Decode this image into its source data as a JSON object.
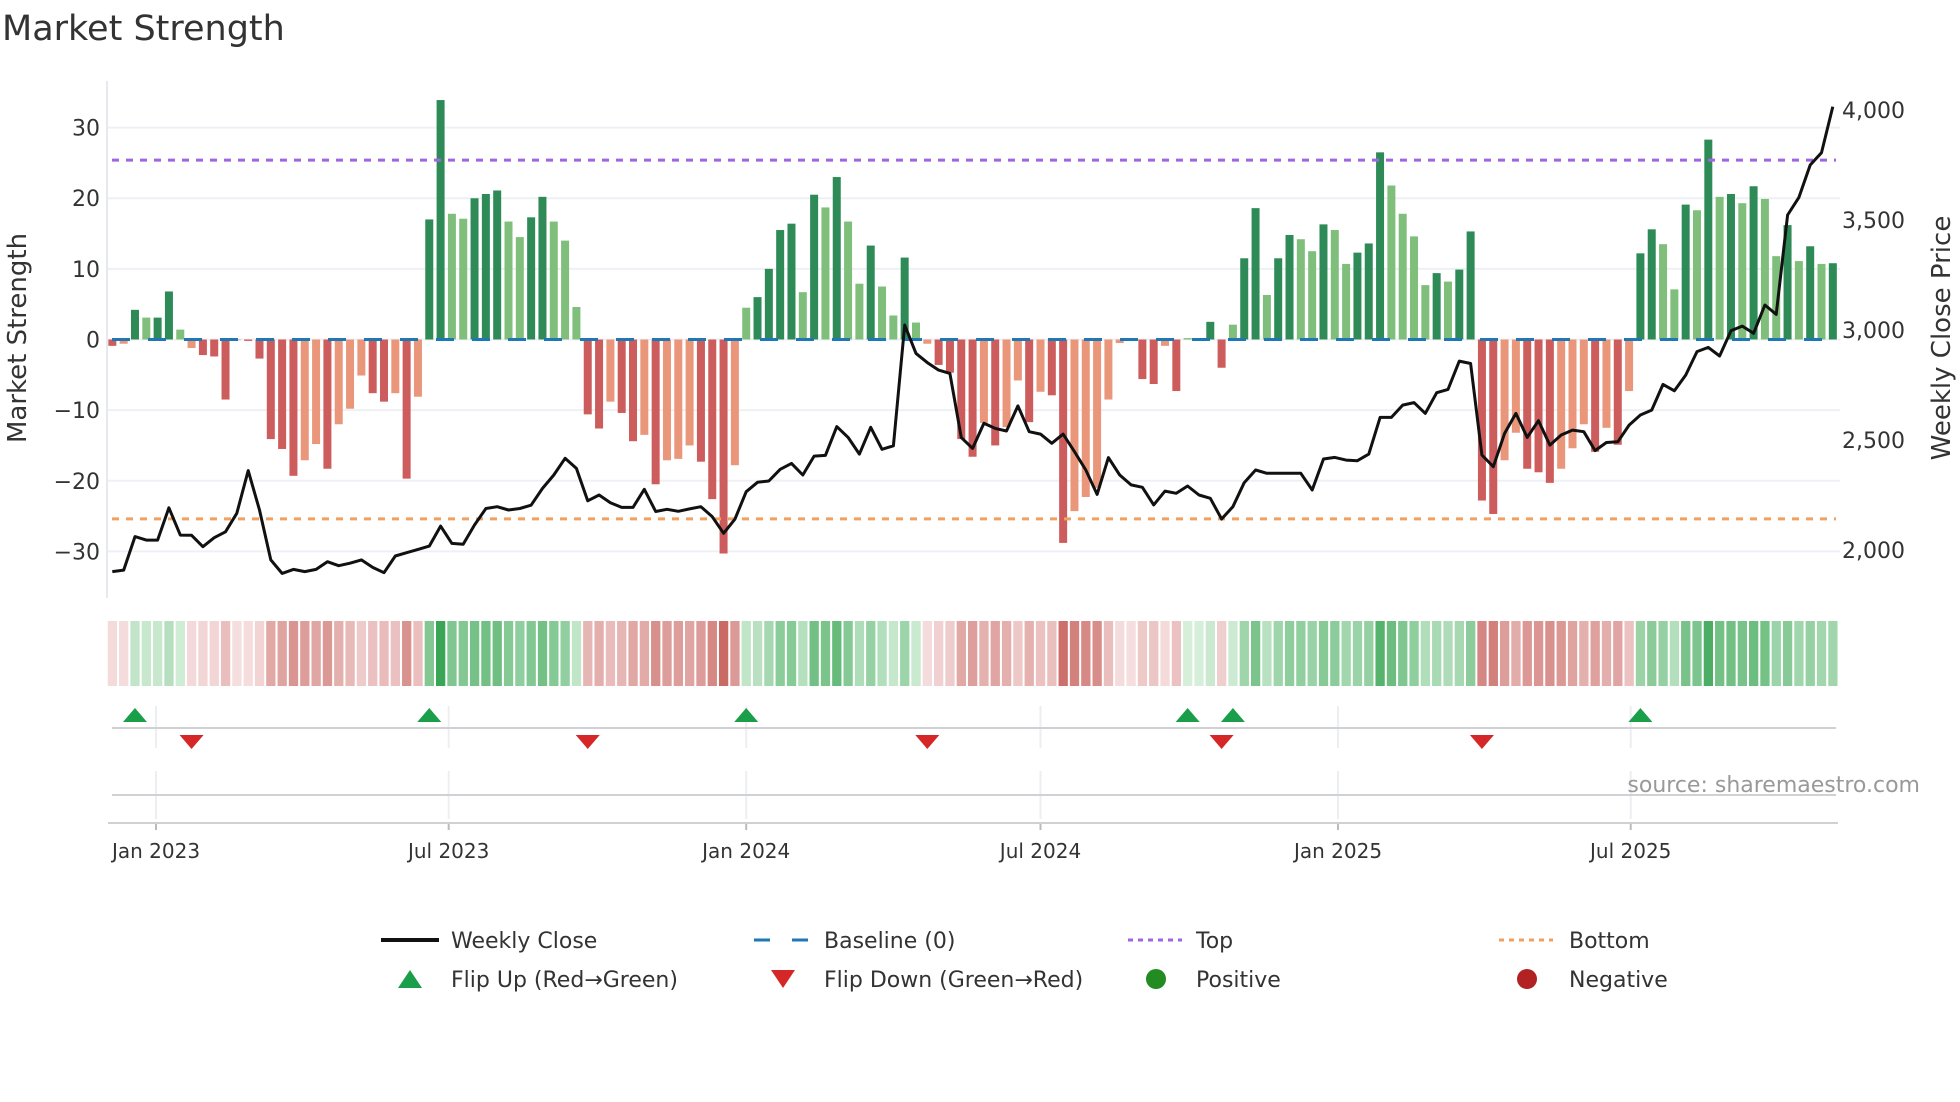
{
  "chart_data": {
    "type": "bar",
    "title": "Market Strength",
    "ylabel": "Market Strength",
    "y2label": "Weekly Close Price",
    "ylim": [
      -36.6,
      36.6
    ],
    "y2lim": [
      1782,
      4132
    ],
    "yticks": [
      -30,
      -20,
      -10,
      0,
      10,
      20,
      30
    ],
    "y2ticks": [
      2000,
      2500,
      3000,
      3500,
      4000
    ],
    "y2tick_labels": [
      "2,000",
      "2,500",
      "3,000",
      "3,500",
      "4,000"
    ],
    "xticks": [
      {
        "date": "2023-01-01",
        "label": "Jan 2023"
      },
      {
        "date": "2023-07-01",
        "label": "Jul 2023"
      },
      {
        "date": "2024-01-01",
        "label": "Jan 2024"
      },
      {
        "date": "2024-07-01",
        "label": "Jul 2024"
      },
      {
        "date": "2025-01-01",
        "label": "Jan 2025"
      },
      {
        "date": "2025-07-01",
        "label": "Jul 2025"
      }
    ],
    "grid": true,
    "legend_placement": "bottom",
    "top_threshold": 25.4,
    "bottom_threshold": -25.4,
    "baseline": 0,
    "x": [
      "2022-12-05",
      "2022-12-12",
      "2022-12-19",
      "2022-12-26",
      "2023-01-02",
      "2023-01-09",
      "2023-01-16",
      "2023-01-23",
      "2023-01-30",
      "2023-02-06",
      "2023-02-13",
      "2023-02-20",
      "2023-02-27",
      "2023-03-06",
      "2023-03-13",
      "2023-03-20",
      "2023-03-27",
      "2023-04-03",
      "2023-04-10",
      "2023-04-17",
      "2023-04-24",
      "2023-05-01",
      "2023-05-08",
      "2023-05-15",
      "2023-05-22",
      "2023-05-29",
      "2023-06-05",
      "2023-06-12",
      "2023-06-19",
      "2023-06-26",
      "2023-07-03",
      "2023-07-10",
      "2023-07-17",
      "2023-07-24",
      "2023-07-31",
      "2023-08-07",
      "2023-08-14",
      "2023-08-21",
      "2023-08-28",
      "2023-09-04",
      "2023-09-11",
      "2023-09-18",
      "2023-09-25",
      "2023-10-02",
      "2023-10-09",
      "2023-10-16",
      "2023-10-23",
      "2023-10-30",
      "2023-11-06",
      "2023-11-13",
      "2023-11-20",
      "2023-11-27",
      "2023-12-04",
      "2023-12-11",
      "2023-12-18",
      "2023-12-25",
      "2024-01-01",
      "2024-01-08",
      "2024-01-15",
      "2024-01-22",
      "2024-01-29",
      "2024-02-05",
      "2024-02-12",
      "2024-02-19",
      "2024-02-26",
      "2024-03-04",
      "2024-03-11",
      "2024-03-18",
      "2024-03-25",
      "2024-04-01",
      "2024-04-08",
      "2024-04-15",
      "2024-04-22",
      "2024-04-29",
      "2024-05-06",
      "2024-05-13",
      "2024-05-20",
      "2024-05-27",
      "2024-06-03",
      "2024-06-10",
      "2024-06-17",
      "2024-06-24",
      "2024-07-01",
      "2024-07-08",
      "2024-07-15",
      "2024-07-22",
      "2024-07-29",
      "2024-08-05",
      "2024-08-12",
      "2024-08-19",
      "2024-08-26",
      "2024-09-02",
      "2024-09-09",
      "2024-09-16",
      "2024-09-23",
      "2024-09-30",
      "2024-10-07",
      "2024-10-14",
      "2024-10-21",
      "2024-10-28",
      "2024-11-04",
      "2024-11-11",
      "2024-11-18",
      "2024-11-25",
      "2024-12-02",
      "2024-12-09",
      "2024-12-16",
      "2024-12-23",
      "2024-12-30",
      "2025-01-06",
      "2025-01-13",
      "2025-01-20",
      "2025-01-27",
      "2025-02-03",
      "2025-02-10",
      "2025-02-17",
      "2025-02-24",
      "2025-03-03",
      "2025-03-10",
      "2025-03-17",
      "2025-03-24",
      "2025-03-31",
      "2025-04-07",
      "2025-04-14",
      "2025-04-21",
      "2025-04-28",
      "2025-05-05",
      "2025-05-12",
      "2025-05-19",
      "2025-05-26",
      "2025-06-02",
      "2025-06-09",
      "2025-06-16",
      "2025-06-23",
      "2025-06-30",
      "2025-07-07",
      "2025-07-14",
      "2025-07-21",
      "2025-07-28",
      "2025-08-04",
      "2025-08-11",
      "2025-08-18",
      "2025-08-25",
      "2025-09-01",
      "2025-09-08",
      "2025-09-15",
      "2025-09-22",
      "2025-09-29",
      "2025-10-06",
      "2025-10-13",
      "2025-10-20",
      "2025-10-27",
      "2025-11-03"
    ],
    "series": [
      {
        "name": "Market Strength",
        "type": "bar",
        "values": [
          -0.9,
          -0.6,
          4.2,
          3.1,
          3.1,
          6.8,
          1.4,
          -1.2,
          -2.2,
          -2.4,
          -8.5,
          -0.1,
          -0.2,
          -2.7,
          -14.1,
          -15.5,
          -19.3,
          -17.1,
          -14.8,
          -18.3,
          -12.0,
          -9.8,
          -5.1,
          -7.6,
          -8.8,
          -7.6,
          -19.7,
          -8.1,
          17.0,
          33.9,
          17.8,
          17.1,
          20.0,
          20.6,
          21.1,
          16.7,
          14.5,
          17.3,
          20.2,
          16.7,
          14.0,
          4.6,
          -10.6,
          -12.6,
          -8.8,
          -10.4,
          -14.4,
          -13.5,
          -20.5,
          -17.1,
          -16.9,
          -15.0,
          -17.3,
          -22.6,
          -30.3,
          -17.8,
          4.5,
          6.0,
          10.0,
          15.5,
          16.4,
          6.7,
          20.5,
          18.7,
          23.0,
          16.7,
          7.9,
          13.3,
          7.5,
          3.4,
          11.6,
          2.4,
          -0.6,
          -3.6,
          -4.7,
          -14.1,
          -16.6,
          -11.8,
          -15.0,
          -12.4,
          -5.8,
          -11.7,
          -7.4,
          -7.9,
          -28.8,
          -24.3,
          -22.3,
          -21.0,
          -8.5,
          -0.5,
          -0.1,
          -5.6,
          -6.3,
          -0.9,
          -7.3,
          0.2,
          0.1,
          2.5,
          -4.0,
          2.1,
          11.5,
          18.6,
          6.3,
          11.5,
          14.8,
          14.2,
          12.5,
          16.3,
          15.5,
          10.7,
          12.3,
          13.6,
          26.5,
          21.8,
          17.8,
          14.6,
          7.7,
          9.4,
          8.2,
          9.9,
          15.3,
          -22.8,
          -24.7,
          -17.1,
          -13.2,
          -18.3,
          -18.8,
          -20.3,
          -18.3,
          -15.4,
          -12.0,
          -15.9,
          -12.5,
          -14.9,
          -7.3,
          12.2,
          15.6,
          13.5,
          7.1,
          19.1,
          18.3,
          28.3,
          20.2,
          20.6,
          19.3,
          21.7,
          19.9,
          11.8,
          16.2,
          11.1,
          13.2,
          10.7,
          10.8
        ]
      },
      {
        "name": "Weekly Close",
        "type": "line",
        "axis": "right",
        "values": [
          1902,
          1909,
          2061,
          2045,
          2045,
          2192,
          2068,
          2067,
          2015,
          2056,
          2083,
          2167,
          2361,
          2182,
          1955,
          1894,
          1912,
          1902,
          1912,
          1947,
          1929,
          1940,
          1955,
          1921,
          1897,
          1973,
          1988,
          2003,
          2018,
          2109,
          2030,
          2026,
          2114,
          2189,
          2197,
          2182,
          2189,
          2204,
          2280,
          2341,
          2417,
          2371,
          2224,
          2250,
          2215,
          2194,
          2194,
          2276,
          2175,
          2185,
          2176,
          2187,
          2197,
          2152,
          2076,
          2140,
          2265,
          2308,
          2314,
          2367,
          2394,
          2341,
          2427,
          2430,
          2561,
          2512,
          2436,
          2558,
          2458,
          2474,
          3023,
          2894,
          2852,
          2818,
          2803,
          2511,
          2462,
          2576,
          2553,
          2541,
          2655,
          2538,
          2527,
          2485,
          2527,
          2447,
          2364,
          2253,
          2420,
          2341,
          2296,
          2285,
          2205,
          2268,
          2258,
          2291,
          2250,
          2235,
          2141,
          2197,
          2306,
          2364,
          2349,
          2349,
          2349,
          2349,
          2273,
          2414,
          2421,
          2409,
          2406,
          2436,
          2603,
          2603,
          2659,
          2670,
          2621,
          2715,
          2730,
          2859,
          2848,
          2432,
          2379,
          2530,
          2621,
          2512,
          2588,
          2477,
          2523,
          2545,
          2538,
          2452,
          2489,
          2492,
          2568,
          2614,
          2636,
          2753,
          2724,
          2795,
          2902,
          2921,
          2882,
          2997,
          3018,
          2985,
          3114,
          3071,
          3523,
          3603,
          3750,
          3806,
          4015
        ]
      }
    ],
    "flip_up": [
      "2022-12-19",
      "2023-06-19",
      "2024-01-01",
      "2024-09-30",
      "2024-10-28",
      "2025-07-07"
    ],
    "flip_down": [
      "2023-01-23",
      "2023-09-25",
      "2024-04-22",
      "2024-10-21",
      "2025-03-31"
    ],
    "colors": {
      "positive_strong": "#2e8b57",
      "positive_weak": "#7fbf7b",
      "negative_strong": "#cd5c5c",
      "negative_weak": "#e9967a",
      "line": "#111111",
      "baseline": "#1f77b4",
      "top": "#a066e0",
      "bottom": "#f0a060",
      "flip_up": "#1a9e4a",
      "flip_down": "#d62728",
      "positive_dot": "#228b22",
      "negative_dot": "#b22222"
    },
    "legend": [
      {
        "label": "Weekly Close",
        "icon": "solid-line"
      },
      {
        "label": "Baseline (0)",
        "icon": "dashed-line"
      },
      {
        "label": "Top",
        "icon": "dotted-line"
      },
      {
        "label": "Bottom",
        "icon": "dotted-line"
      },
      {
        "label": "Flip Up (Red→Green)",
        "icon": "triangle-up"
      },
      {
        "label": "Flip Down (Green→Red)",
        "icon": "triangle-down"
      },
      {
        "label": "Positive",
        "icon": "circle"
      },
      {
        "label": "Negative",
        "icon": "circle"
      }
    ],
    "source": "source: sharemaestro.com"
  }
}
